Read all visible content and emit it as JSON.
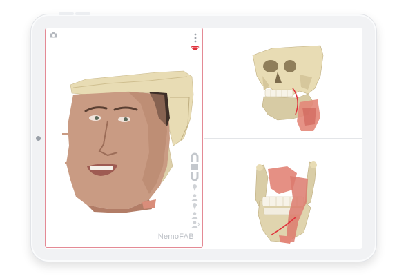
{
  "app": {
    "brand_watermark": "NemoFAB"
  },
  "left_panel": {
    "view": "3d-face-with-skull-overlay",
    "toolbar_icons": [
      "camera-icon",
      "more-vertical-icon",
      "lips-icon",
      "magnet-open-icon",
      "magnet-closed-icon",
      "pin-icon",
      "person-icon",
      "pin-icon-2",
      "person-icon-2",
      "person-icon-3",
      "person-rotate-icon"
    ]
  },
  "right_top_panel": {
    "view": "3d-skull-with-osteotomy"
  },
  "right_bottom_panel": {
    "view": "3d-mandible-with-osteotomy"
  },
  "colors": {
    "accent": "#e0323c",
    "bone": "#e6d9b0",
    "skin": "#c89a82",
    "panel_border": "#e48a95"
  }
}
